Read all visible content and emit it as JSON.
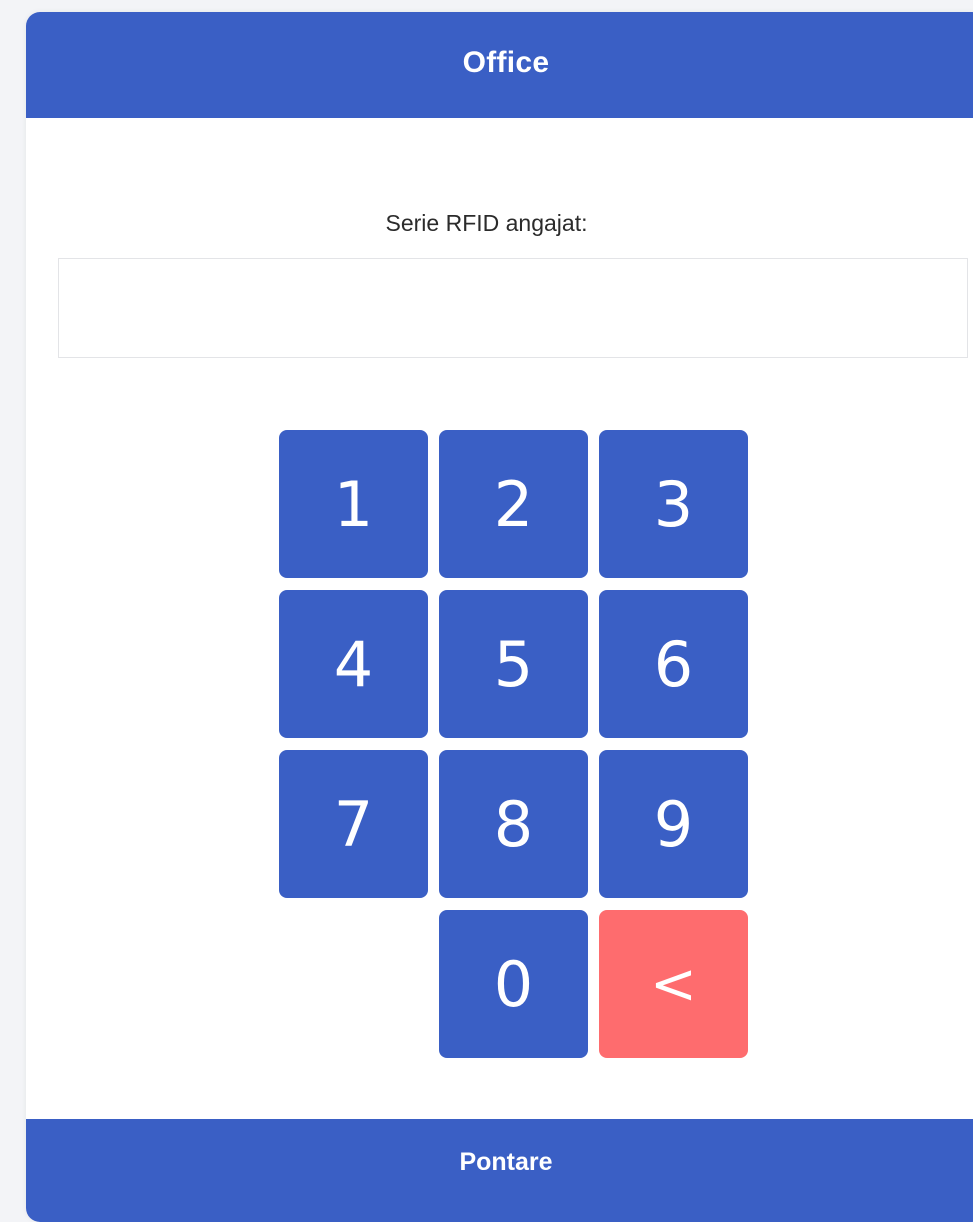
{
  "header": {
    "title": "Office"
  },
  "form": {
    "rfid_label": "Serie RFID angajat:",
    "rfid_value": "",
    "rfid_placeholder": ""
  },
  "keypad": {
    "keys": [
      "1",
      "2",
      "3",
      "4",
      "5",
      "6",
      "7",
      "8",
      "9",
      "0"
    ],
    "backspace_label": "<"
  },
  "footer": {
    "submit_label": "Pontare"
  },
  "colors": {
    "primary": "#3a5fc5",
    "backspace": "#fe6c6e",
    "background": "#ffffff"
  }
}
